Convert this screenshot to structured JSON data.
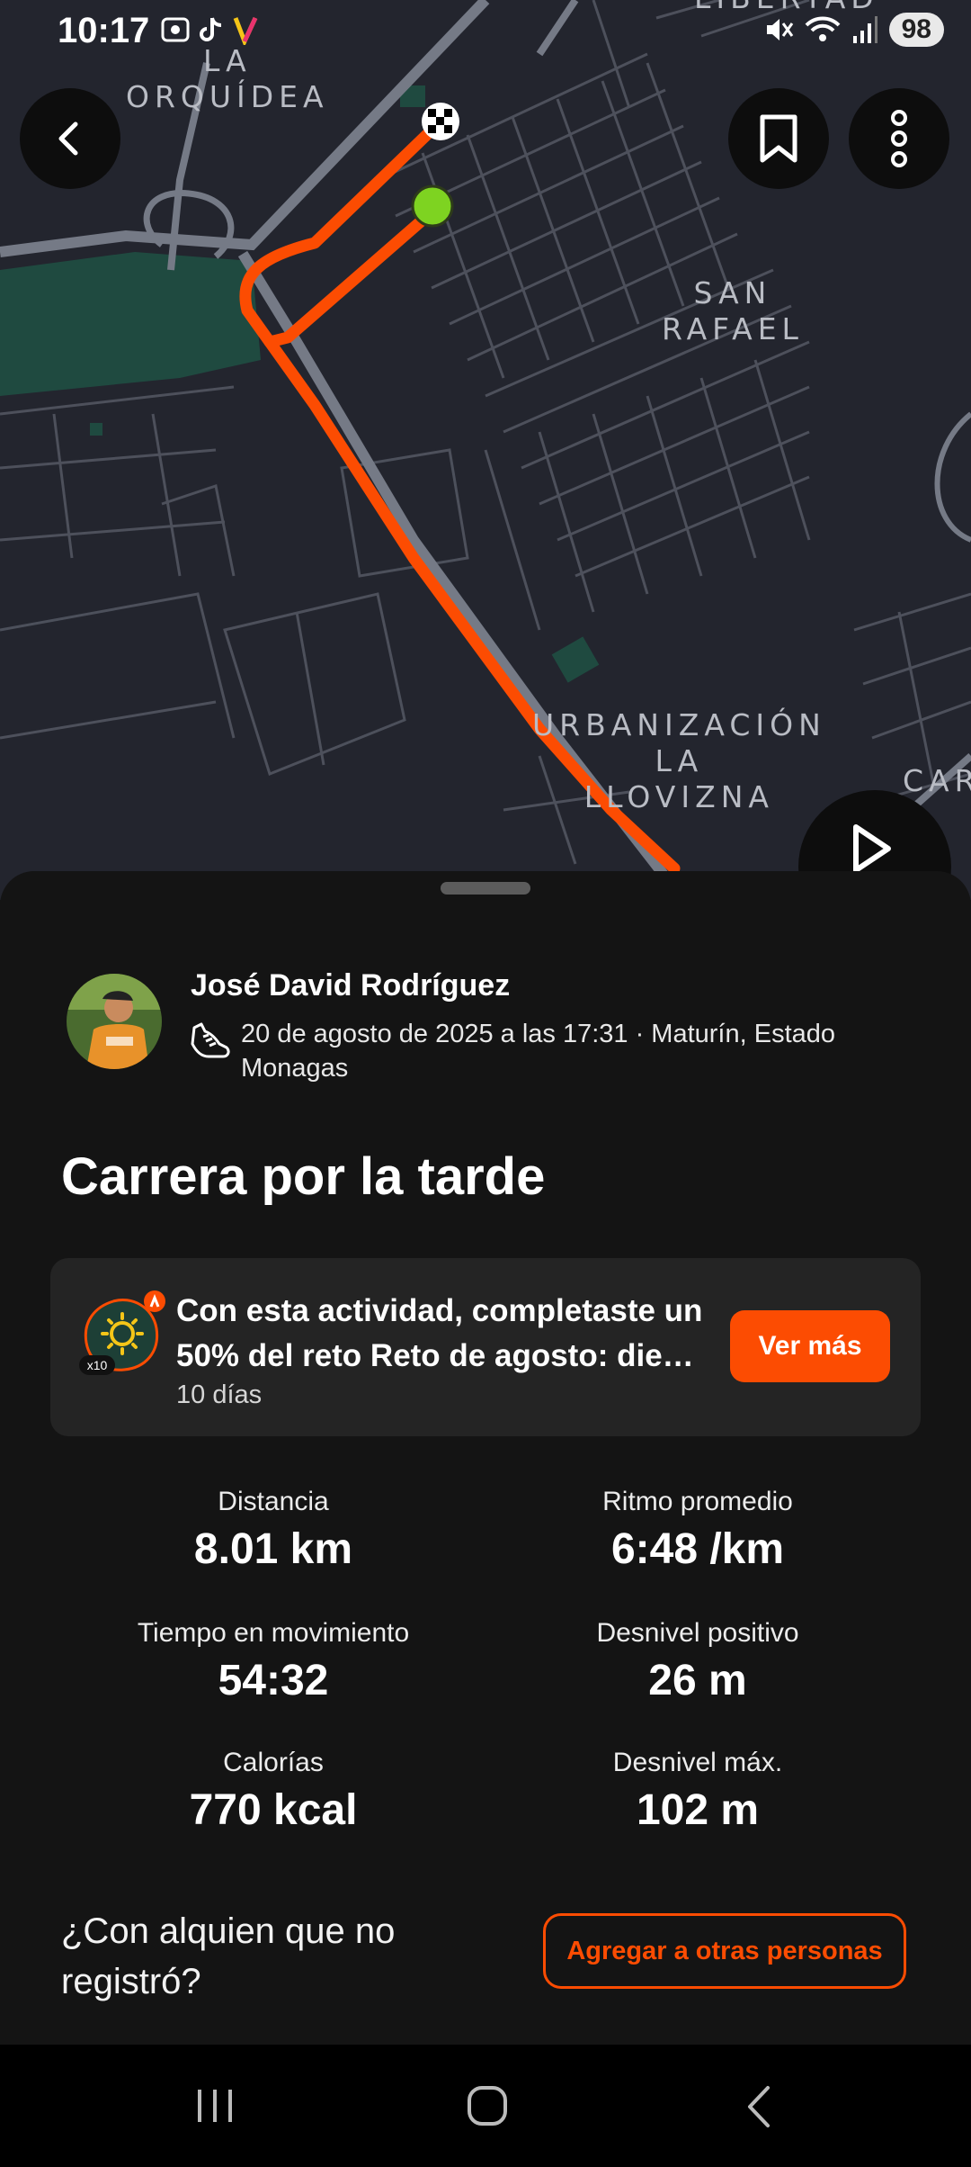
{
  "status_bar": {
    "time": "10:17",
    "battery": "98",
    "icons": [
      "screenshot-icon",
      "tiktok-icon",
      "app-icon",
      "mute-icon",
      "wifi-icon",
      "signal-icon"
    ]
  },
  "map": {
    "labels": {
      "la_orquidea": "LA\nORQUÍDEA",
      "san_rafael": "SAN\nRAFAEL",
      "urbanizacion": "URBANIZACIÓN\nLA\nLLOVIZNA",
      "libertad": "LIBERTAD",
      "car": "CAR"
    },
    "route_color": "#fc4c02",
    "start_marker_color": "#7ed321"
  },
  "activity": {
    "athlete_name": "José David Rodríguez",
    "meta": "20 de agosto de 2025 a las 17:31 · Maturín, Estado Monagas",
    "title": "Carrera por la tarde"
  },
  "challenge": {
    "line1": "Con esta actividad, completaste un",
    "line2": "50% del reto Reto de agosto: diez ...",
    "sub": "10 días",
    "badge_text": "x10",
    "button": "Ver más"
  },
  "stats": [
    {
      "label": "Distancia",
      "value": "8.01 km"
    },
    {
      "label": "Ritmo promedio",
      "value": "6:48 /km"
    },
    {
      "label": "Tiempo en movimiento",
      "value": "54:32"
    },
    {
      "label": "Desnivel positivo",
      "value": "26 m"
    },
    {
      "label": "Calorías",
      "value": "770 kcal"
    },
    {
      "label": "Desnivel máx.",
      "value": "102 m"
    }
  ],
  "footer": {
    "question": "¿Con alquien que no registró?",
    "button": "Agregar a otras personas"
  },
  "colors": {
    "accent": "#fc4c02",
    "background": "#141414",
    "card": "#242424"
  }
}
